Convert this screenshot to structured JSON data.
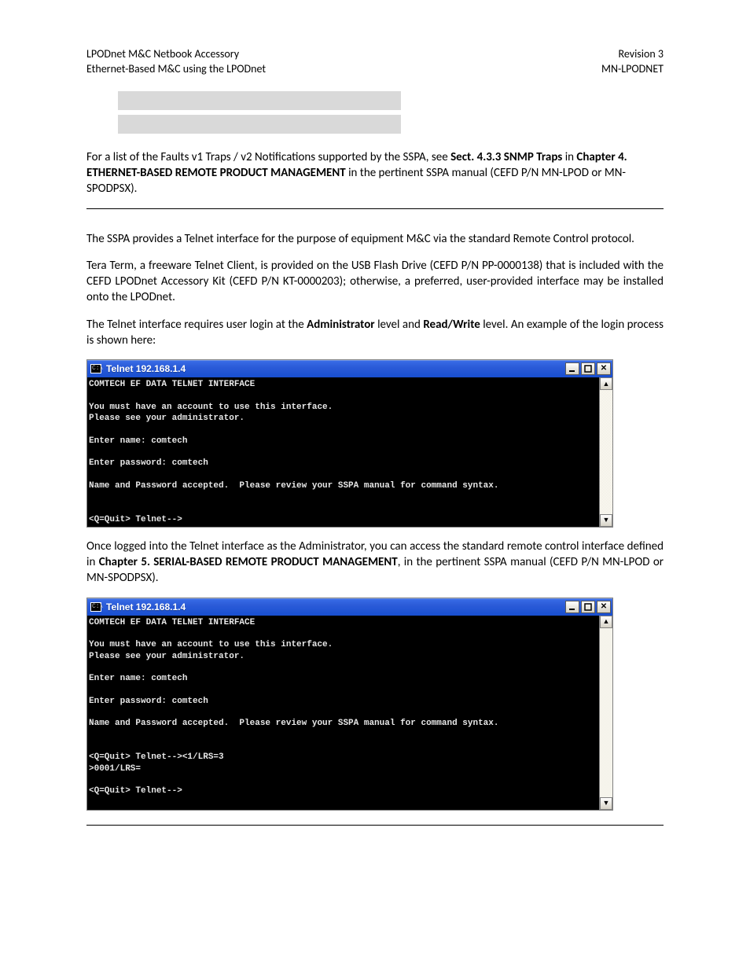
{
  "header": {
    "left_line1": "LPODnet M&C Netbook Accessory",
    "left_line2": "Ethernet-Based M&C using the LPODnet",
    "right_line1": "Revision 3",
    "right_line2": "MN-LPODNET"
  },
  "para1": {
    "pre": "For a list of the Faults v1 Traps / v2 Notifications supported by the SSPA, see ",
    "b1": "Sect. 4.3.3 SNMP Traps",
    "mid1": " in ",
    "b2": "Chapter 4. ETHERNET-BASED REMOTE PRODUCT MANAGEMENT",
    "post": " in the pertinent SSPA manual (CEFD P/N MN-LPOD or MN-SPODPSX)."
  },
  "para2": "The SSPA provides a Telnet interface for the purpose of equipment M&C via the standard Remote Control protocol.",
  "para3": "Tera Term, a freeware Telnet Client, is provided on the USB Flash Drive (CEFD P/N PP-0000138) that is included with the CEFD LPODnet Accessory Kit (CEFD P/N KT-0000203); otherwise, a preferred, user-provided interface may be installed onto the LPODnet.",
  "para4": {
    "pre": "The Telnet interface requires user login at the ",
    "b1": "Administrator",
    "mid1": " level and ",
    "b2": "Read/Write",
    "post": " level. An example of the login process is shown here:"
  },
  "para5": {
    "pre": "Once logged into the Telnet interface as the Administrator, you can access the standard remote control interface defined in ",
    "b1": "Chapter 5. SERIAL-BASED REMOTE PRODUCT MANAGEMENT",
    "post": ", in the pertinent SSPA manual (CEFD P/N MN-LPOD or MN-SPODPSX)."
  },
  "telnet1": {
    "title": "Telnet 192.168.1.4",
    "icon_label": "C:\\",
    "content": "COMTECH EF DATA TELNET INTERFACE\n\nYou must have an account to use this interface.\nPlease see your administrator.\n\nEnter name: comtech\n\nEnter password: comtech\n\nName and Password accepted.  Please review your SSPA manual for command syntax.\n\n\n<Q=Quit> Telnet-->\n"
  },
  "telnet2": {
    "title": "Telnet 192.168.1.4",
    "icon_label": "C:\\",
    "content": "COMTECH EF DATA TELNET INTERFACE\n\nYou must have an account to use this interface.\nPlease see your administrator.\n\nEnter name: comtech\n\nEnter password: comtech\n\nName and Password accepted.  Please review your SSPA manual for command syntax.\n\n\n<Q=Quit> Telnet--><1/LRS=3\n>0001/LRS=\n\n<Q=Quit> Telnet-->\n\n"
  },
  "scroll": {
    "up": "▲",
    "down": "▼"
  },
  "winbtn": {
    "close": "✕"
  }
}
